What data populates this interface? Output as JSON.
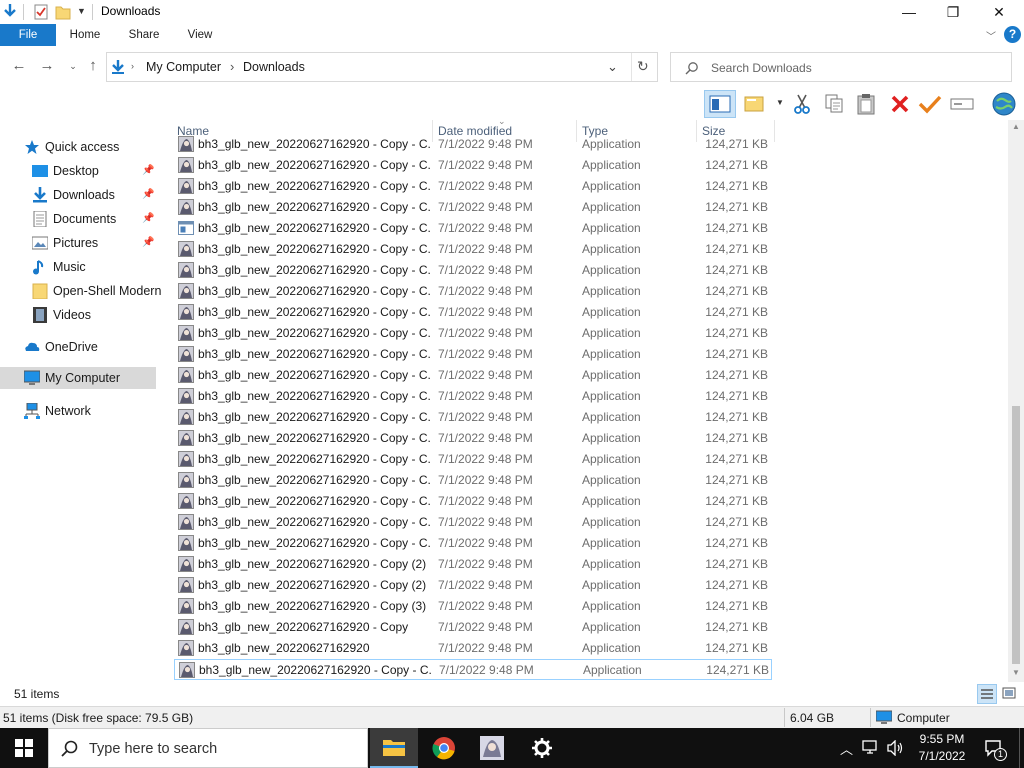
{
  "window": {
    "title": "Downloads",
    "controls": {
      "minimize": "—",
      "maximize": "❐",
      "close": "✕"
    }
  },
  "ribbon": {
    "tabs": [
      "File",
      "Home",
      "Share",
      "View"
    ],
    "help": "?"
  },
  "address": {
    "crumbs": [
      "My Computer",
      "Downloads"
    ],
    "search_placeholder": "Search Downloads"
  },
  "nav": {
    "quick_access": "Quick access",
    "items": [
      {
        "label": "Desktop",
        "icon": "desktop-icon",
        "pinned": true
      },
      {
        "label": "Downloads",
        "icon": "downloads-icon",
        "pinned": true
      },
      {
        "label": "Documents",
        "icon": "documents-icon",
        "pinned": true
      },
      {
        "label": "Pictures",
        "icon": "pictures-icon",
        "pinned": true
      },
      {
        "label": "Music",
        "icon": "music-icon",
        "pinned": false
      },
      {
        "label": "Open-Shell Modern",
        "icon": "folder-icon",
        "pinned": false
      },
      {
        "label": "Videos",
        "icon": "videos-icon",
        "pinned": false
      }
    ],
    "onedrive": "OneDrive",
    "my_computer": "My Computer",
    "network": "Network"
  },
  "columns": {
    "name": "Name",
    "date": "Date modified",
    "type": "Type",
    "size": "Size"
  },
  "files": [
    {
      "name": "bh3_glb_new_20220627162920 - Copy - C...",
      "date": "7/1/2022 9:48 PM",
      "type": "Application",
      "size": "124,271 KB"
    },
    {
      "name": "bh3_glb_new_20220627162920 - Copy - C...",
      "date": "7/1/2022 9:48 PM",
      "type": "Application",
      "size": "124,271 KB"
    },
    {
      "name": "bh3_glb_new_20220627162920 - Copy - C...",
      "date": "7/1/2022 9:48 PM",
      "type": "Application",
      "size": "124,271 KB"
    },
    {
      "name": "bh3_glb_new_20220627162920 - Copy - C...",
      "date": "7/1/2022 9:48 PM",
      "type": "Application",
      "size": "124,271 KB"
    },
    {
      "name": "bh3_glb_new_20220627162920 - Copy - C...",
      "date": "7/1/2022 9:48 PM",
      "type": "Application",
      "size": "124,271 KB",
      "alt_icon": true
    },
    {
      "name": "bh3_glb_new_20220627162920 - Copy - C...",
      "date": "7/1/2022 9:48 PM",
      "type": "Application",
      "size": "124,271 KB"
    },
    {
      "name": "bh3_glb_new_20220627162920 - Copy - C...",
      "date": "7/1/2022 9:48 PM",
      "type": "Application",
      "size": "124,271 KB"
    },
    {
      "name": "bh3_glb_new_20220627162920 - Copy - C...",
      "date": "7/1/2022 9:48 PM",
      "type": "Application",
      "size": "124,271 KB"
    },
    {
      "name": "bh3_glb_new_20220627162920 - Copy - C...",
      "date": "7/1/2022 9:48 PM",
      "type": "Application",
      "size": "124,271 KB"
    },
    {
      "name": "bh3_glb_new_20220627162920 - Copy - C...",
      "date": "7/1/2022 9:48 PM",
      "type": "Application",
      "size": "124,271 KB"
    },
    {
      "name": "bh3_glb_new_20220627162920 - Copy - C...",
      "date": "7/1/2022 9:48 PM",
      "type": "Application",
      "size": "124,271 KB"
    },
    {
      "name": "bh3_glb_new_20220627162920 - Copy - C...",
      "date": "7/1/2022 9:48 PM",
      "type": "Application",
      "size": "124,271 KB"
    },
    {
      "name": "bh3_glb_new_20220627162920 - Copy - C...",
      "date": "7/1/2022 9:48 PM",
      "type": "Application",
      "size": "124,271 KB"
    },
    {
      "name": "bh3_glb_new_20220627162920 - Copy - C...",
      "date": "7/1/2022 9:48 PM",
      "type": "Application",
      "size": "124,271 KB"
    },
    {
      "name": "bh3_glb_new_20220627162920 - Copy - C...",
      "date": "7/1/2022 9:48 PM",
      "type": "Application",
      "size": "124,271 KB"
    },
    {
      "name": "bh3_glb_new_20220627162920 - Copy - C...",
      "date": "7/1/2022 9:48 PM",
      "type": "Application",
      "size": "124,271 KB"
    },
    {
      "name": "bh3_glb_new_20220627162920 - Copy - C...",
      "date": "7/1/2022 9:48 PM",
      "type": "Application",
      "size": "124,271 KB"
    },
    {
      "name": "bh3_glb_new_20220627162920 - Copy - C...",
      "date": "7/1/2022 9:48 PM",
      "type": "Application",
      "size": "124,271 KB"
    },
    {
      "name": "bh3_glb_new_20220627162920 - Copy - C...",
      "date": "7/1/2022 9:48 PM",
      "type": "Application",
      "size": "124,271 KB"
    },
    {
      "name": "bh3_glb_new_20220627162920 - Copy - C...",
      "date": "7/1/2022 9:48 PM",
      "type": "Application",
      "size": "124,271 KB"
    },
    {
      "name": "bh3_glb_new_20220627162920 - Copy (2) ...",
      "date": "7/1/2022 9:48 PM",
      "type": "Application",
      "size": "124,271 KB"
    },
    {
      "name": "bh3_glb_new_20220627162920 - Copy (2)",
      "date": "7/1/2022 9:48 PM",
      "type": "Application",
      "size": "124,271 KB"
    },
    {
      "name": "bh3_glb_new_20220627162920 - Copy (3)",
      "date": "7/1/2022 9:48 PM",
      "type": "Application",
      "size": "124,271 KB"
    },
    {
      "name": "bh3_glb_new_20220627162920 - Copy",
      "date": "7/1/2022 9:48 PM",
      "type": "Application",
      "size": "124,271 KB"
    },
    {
      "name": "bh3_glb_new_20220627162920",
      "date": "7/1/2022 9:48 PM",
      "type": "Application",
      "size": "124,271 KB"
    },
    {
      "name": "bh3_glb_new_20220627162920 - Copy - C...",
      "date": "7/1/2022 9:48 PM",
      "type": "Application",
      "size": "124,271 KB",
      "focused": true
    }
  ],
  "status": {
    "count": "51 items",
    "details": "51 items (Disk free space: 79.5 GB)",
    "selected_size": "6.04 GB",
    "location": "Computer"
  },
  "taskbar": {
    "search_placeholder": "Type here to search",
    "time": "9:55 PM",
    "date": "7/1/2022",
    "notifications": "1"
  },
  "colors": {
    "accent": "#1979ca",
    "taskbar": "#101010"
  }
}
